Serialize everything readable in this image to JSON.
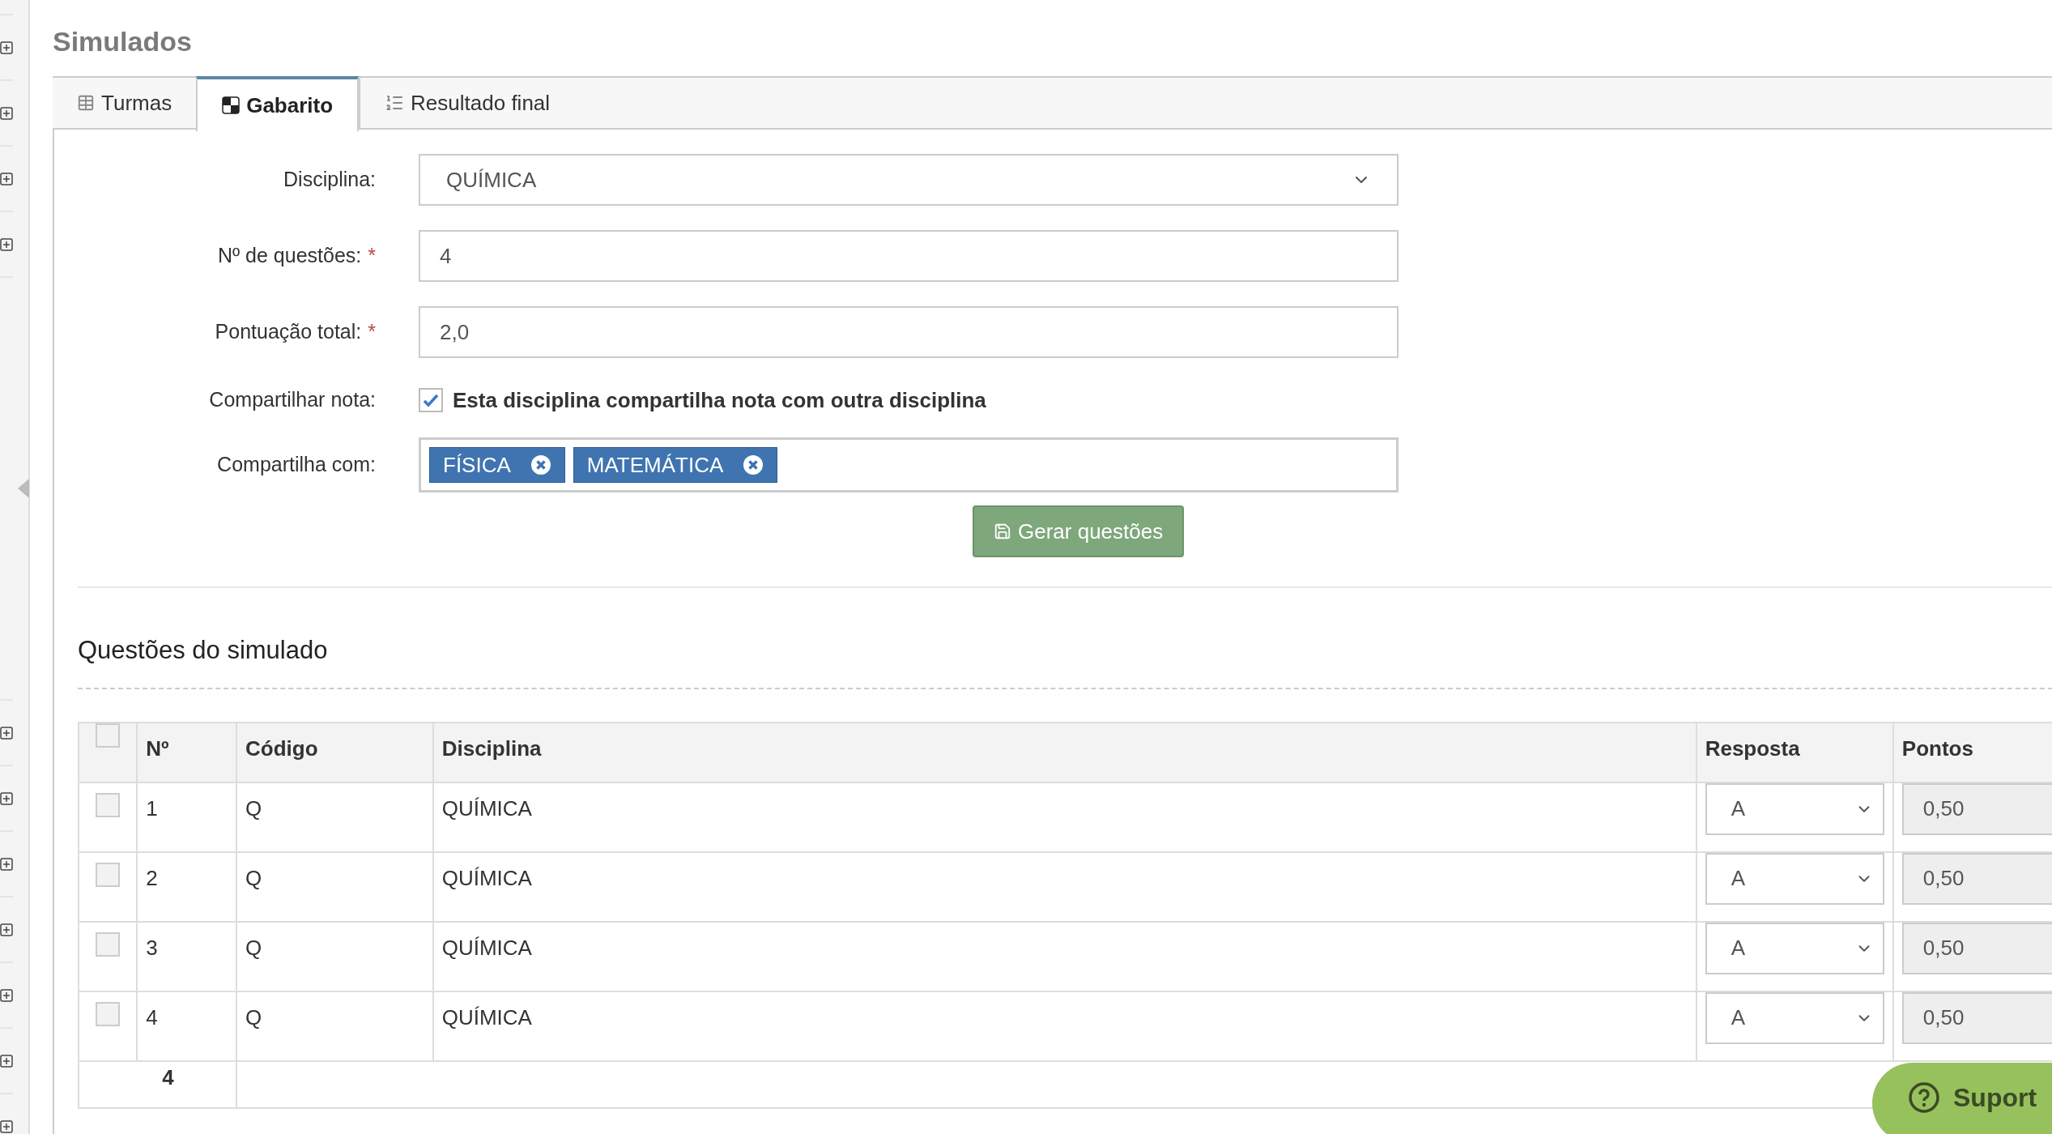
{
  "title": "Simulados",
  "tabs": [
    {
      "label": "Turmas",
      "selected": false
    },
    {
      "label": "Gabarito",
      "selected": true
    },
    {
      "label": "Resultado final",
      "selected": false
    }
  ],
  "form": {
    "fields": [
      {
        "kind": "select",
        "label": "Disciplina:",
        "value": "QUÍMICA"
      },
      {
        "kind": "input",
        "label": "Nº de questões:",
        "value": "4",
        "required_mark": "*"
      },
      {
        "kind": "input",
        "label": "Pontuação total:",
        "value": "2,0",
        "required_mark": "*"
      },
      {
        "kind": "checkbox",
        "label": "Compartilhar nota:",
        "checkbox_label": "Esta disciplina compartilha nota com outra disciplina",
        "checked": true
      },
      {
        "kind": "tags",
        "label": "Compartilha com:",
        "tags": [
          "FÍSICA",
          "MATEMÁTICA"
        ]
      }
    ],
    "submit": "Gerar questões"
  },
  "section_title": "Questões do simulado",
  "table": {
    "select_all_checked": false,
    "columns": [
      "Nº",
      "Código",
      "Disciplina",
      "Resposta",
      "Pontos"
    ],
    "rows": [
      {
        "checked": false,
        "number": "1",
        "code": "Q",
        "discipline": "QUÍMICA",
        "answer": "A",
        "points": "0,50"
      },
      {
        "checked": false,
        "number": "2",
        "code": "Q",
        "discipline": "QUÍMICA",
        "answer": "A",
        "points": "0,50"
      },
      {
        "checked": false,
        "number": "3",
        "code": "Q",
        "discipline": "QUÍMICA",
        "answer": "A",
        "points": "0,50"
      },
      {
        "checked": false,
        "number": "4",
        "code": "Q",
        "discipline": "QUÍMICA",
        "answer": "A",
        "points": "0,50"
      }
    ],
    "footer_count": "4"
  },
  "support_button": "Suport"
}
